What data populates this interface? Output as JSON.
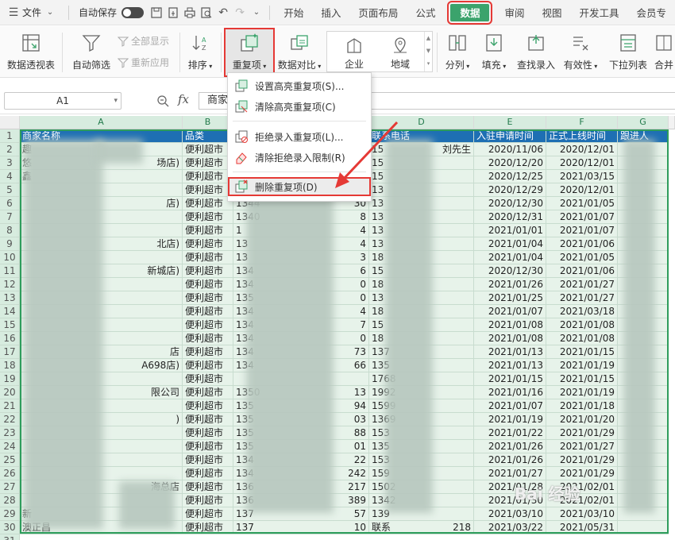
{
  "menubar": {
    "file_label": "文件",
    "autosave_label": "自动保存",
    "tabs": [
      "开始",
      "插入",
      "页面布局",
      "公式",
      "数据",
      "审阅",
      "视图",
      "开发工具",
      "会员专"
    ]
  },
  "ribbon": {
    "pivot": "数据透视表",
    "autofilter": "自动筛选",
    "show_all": "全部显示",
    "reapply": "重新应用",
    "sort": "排序",
    "duplicates": "重复项",
    "compare": "数据对比",
    "type_company": "企业",
    "type_region": "地域",
    "split": "分列",
    "fill": "填充",
    "lookup": "查找录入",
    "validity": "有效性",
    "dropdown_list": "下拉列表",
    "merge": "合并"
  },
  "formula_bar": {
    "name_box": "A1",
    "fx": "fx",
    "content": "商家"
  },
  "dropdown": {
    "items": [
      "设置高亮重复项(S)...",
      "清除高亮重复项(C)",
      "拒绝录入重复项(L)...",
      "清除拒绝录入限制(R)",
      "删除重复项(D)"
    ]
  },
  "sheet": {
    "columns": [
      "A",
      "B",
      "C",
      "D",
      "E",
      "F",
      "G"
    ],
    "headers": [
      "商家名称",
      "品类",
      "",
      "联系电话",
      "入驻申请时间",
      "正式上线时间",
      "跟进人"
    ],
    "rows": [
      {
        "n": "2",
        "a": "趣",
        "b": "便利超市",
        "c": "",
        "d": "15",
        "d2": "刘先生",
        "e": "2020/11/06",
        "f": "2020/12/01"
      },
      {
        "n": "3",
        "a": "悠",
        "a2": "场店)",
        "b": "便利超市",
        "c": "",
        "d": "15",
        "e": "2020/12/20",
        "f": "2020/12/01"
      },
      {
        "n": "4",
        "a": "鑫",
        "b": "便利超市",
        "c": "",
        "d": "15",
        "e": "2020/12/25",
        "f": "2021/03/15"
      },
      {
        "n": "5",
        "a": "",
        "b": "便利超市",
        "c": "",
        "d": "13",
        "e": "2020/12/29",
        "f": "2020/12/01"
      },
      {
        "n": "6",
        "a": "",
        "a2": "店)",
        "b": "便利超市",
        "c": "1344",
        "c2": "30",
        "d": "13",
        "e": "2020/12/30",
        "f": "2021/01/05"
      },
      {
        "n": "7",
        "a": "",
        "b": "便利超市",
        "c": "1340",
        "c2": "8",
        "d": "13",
        "e": "2020/12/31",
        "f": "2021/01/07"
      },
      {
        "n": "8",
        "a": "",
        "b": "便利超市",
        "c": "1",
        "c2": "4",
        "d": "13",
        "e": "2021/01/01",
        "f": "2021/01/07"
      },
      {
        "n": "9",
        "a": "",
        "a2": "北店)",
        "b": "便利超市",
        "c": "13",
        "c2": "4",
        "d": "13",
        "e": "2021/01/04",
        "f": "2021/01/06"
      },
      {
        "n": "10",
        "a": "",
        "b": "便利超市",
        "c": "13",
        "c2": "3",
        "d": "18",
        "e": "2021/01/04",
        "f": "2021/01/05"
      },
      {
        "n": "11",
        "a": "",
        "a2": "新城店)",
        "b": "便利超市",
        "c": "134",
        "c2": "6",
        "d": "15",
        "e": "2020/12/30",
        "f": "2021/01/06"
      },
      {
        "n": "12",
        "a": "",
        "b": "便利超市",
        "c": "134",
        "c2": "0",
        "d": "18",
        "e": "2021/01/26",
        "f": "2021/01/27"
      },
      {
        "n": "13",
        "a": "",
        "b": "便利超市",
        "c": "135",
        "c2": "0",
        "d": "13",
        "e": "2021/01/25",
        "f": "2021/01/27"
      },
      {
        "n": "14",
        "a": "",
        "b": "便利超市",
        "c": "134",
        "c2": "4",
        "d": "18",
        "e": "2021/01/07",
        "f": "2021/03/18"
      },
      {
        "n": "15",
        "a": "",
        "b": "便利超市",
        "c": "134",
        "c2": "7",
        "d": "15",
        "e": "2021/01/08",
        "f": "2021/01/08"
      },
      {
        "n": "16",
        "a": "",
        "b": "便利超市",
        "c": "134",
        "c2": "0",
        "d": "18",
        "e": "2021/01/08",
        "f": "2021/01/08"
      },
      {
        "n": "17",
        "a": "",
        "a2": "店",
        "b": "便利超市",
        "c": "134",
        "c2": "73",
        "d": "137",
        "e": "2021/01/13",
        "f": "2021/01/15"
      },
      {
        "n": "18",
        "a": "",
        "a2": "A698店)",
        "b": "便利超市",
        "c": "134",
        "c2": "66",
        "d": "135",
        "e": "2021/01/13",
        "f": "2021/01/19"
      },
      {
        "n": "19",
        "a": "",
        "b": "便利超市",
        "c": "",
        "c2": "",
        "d": "1768",
        "e": "2021/01/15",
        "f": "2021/01/15"
      },
      {
        "n": "20",
        "a": "",
        "a2": "限公司",
        "b": "便利超市",
        "c": "1350",
        "c2": "13",
        "d": "1992",
        "e": "2021/01/16",
        "f": "2021/01/19"
      },
      {
        "n": "21",
        "a": "",
        "b": "便利超市",
        "c": "135",
        "c2": "94",
        "d": "1599",
        "e": "2021/01/07",
        "f": "2021/01/18"
      },
      {
        "n": "22",
        "a": "",
        "a2": ")",
        "b": "便利超市",
        "c": "135",
        "c2": "03",
        "d": "1369",
        "e": "2021/01/19",
        "f": "2021/01/20"
      },
      {
        "n": "23",
        "a": "",
        "b": "便利超市",
        "c": "135",
        "c2": "88",
        "d": "153",
        "e": "2021/01/22",
        "f": "2021/01/29"
      },
      {
        "n": "24",
        "a": "",
        "b": "便利超市",
        "c": "135",
        "c2": "01",
        "d": "135",
        "e": "2021/01/26",
        "f": "2021/01/27"
      },
      {
        "n": "25",
        "a": "",
        "b": "便利超市",
        "c": "134",
        "c2": "22",
        "d": "153",
        "e": "2021/01/26",
        "f": "2021/01/29"
      },
      {
        "n": "26",
        "a": "",
        "b": "便利超市",
        "c": "134",
        "c2": "242",
        "d": "159",
        "e": "2021/01/27",
        "f": "2021/01/29"
      },
      {
        "n": "27",
        "a": "",
        "a2": "海总店",
        "b": "便利超市",
        "c": "136",
        "c2": "217",
        "d": "1502",
        "e": "2021/01/28",
        "f": "2021/02/01"
      },
      {
        "n": "28",
        "a": "",
        "b": "便利超市",
        "c": "136",
        "c2": "389",
        "d": "1342",
        "e": "2021/01/30",
        "f": "2021/02/01"
      },
      {
        "n": "29",
        "a": "新",
        "b": "便利超市",
        "c": "137",
        "c2": "57",
        "d": "139",
        "e": "2021/03/10",
        "f": "2021/03/10"
      },
      {
        "n": "30",
        "a": "澳正昌",
        "b": "便利超市",
        "c": "137",
        "c2": "10",
        "d": "联系",
        "d2": "218",
        "e": "2021/03/22",
        "f": "2021/05/31"
      }
    ],
    "row_header_first": "1",
    "row_header_last": "31"
  },
  "watermark": "Bai 经验",
  "colors": {
    "accent": "#3ba36c",
    "highlight": "#e53935",
    "header_fill": "#1e6fb3",
    "cell_fill": "#e7f3ea"
  }
}
